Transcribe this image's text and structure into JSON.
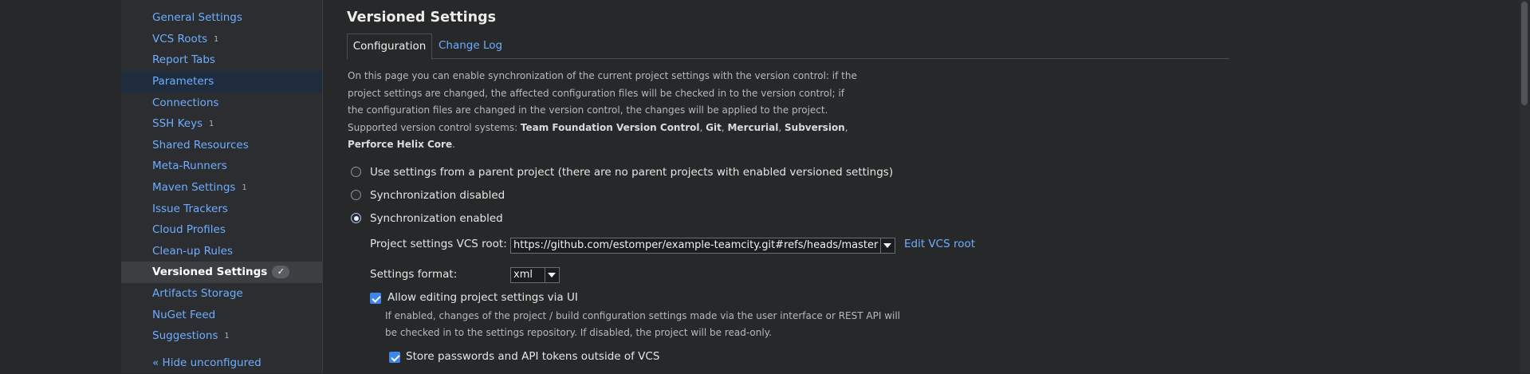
{
  "sidebar": {
    "items": [
      {
        "label": "General Settings",
        "count": ""
      },
      {
        "label": "VCS Roots",
        "count": "1"
      },
      {
        "label": "Report Tabs",
        "count": ""
      },
      {
        "label": "Parameters",
        "count": ""
      },
      {
        "label": "Connections",
        "count": ""
      },
      {
        "label": "SSH Keys",
        "count": "1"
      },
      {
        "label": "Shared Resources",
        "count": ""
      },
      {
        "label": "Meta-Runners",
        "count": ""
      },
      {
        "label": "Maven Settings",
        "count": "1"
      },
      {
        "label": "Issue Trackers",
        "count": ""
      },
      {
        "label": "Cloud Profiles",
        "count": ""
      },
      {
        "label": "Clean-up Rules",
        "count": ""
      },
      {
        "label": "Versioned Settings",
        "count": ""
      },
      {
        "label": "Artifacts Storage",
        "count": ""
      },
      {
        "label": "NuGet Feed",
        "count": ""
      },
      {
        "label": "Suggestions",
        "count": "1"
      }
    ],
    "hide_link": "« Hide unconfigured",
    "active_check": "✓"
  },
  "main": {
    "title": "Versioned Settings",
    "tabs": [
      {
        "label": "Configuration"
      },
      {
        "label": "Change Log"
      }
    ],
    "description": {
      "p1": "On this page you can enable synchronization of the current project settings with the version control: if the project settings are changed, the affected configuration files will be checked in to the version control; if the configuration files are changed in the version control, the changes will be applied to the project.",
      "supported_prefix": "Supported version control systems: ",
      "systems": [
        "Team Foundation Version Control",
        "Git",
        "Mercurial",
        "Subversion",
        "Perforce Helix Core"
      ],
      "sep": ", ",
      "end": "."
    },
    "radios": [
      {
        "label": "Use settings from a parent project (there are no parent projects with enabled versioned settings)",
        "checked": false
      },
      {
        "label": "Synchronization disabled",
        "checked": false
      },
      {
        "label": "Synchronization enabled",
        "checked": true
      }
    ],
    "vcs_root": {
      "label": "Project settings VCS root:",
      "value": "https://github.com/estomper/example-teamcity.git#refs/heads/master",
      "edit_link": "Edit VCS root"
    },
    "format": {
      "label": "Settings format:",
      "value": "xml"
    },
    "allow_editing": {
      "label": "Allow editing project settings via UI",
      "checked": true,
      "hint": "If enabled, changes of the project / build configuration settings made via the user interface or REST API will be checked in to the settings repository. If disabled, the project will be read-only."
    },
    "store_passwords": {
      "label": "Store passwords and API tokens outside of VCS",
      "checked": true
    }
  },
  "colors": {
    "link": "#6eaeff",
    "background": "#262829",
    "checkbox": "#3e86ea"
  }
}
